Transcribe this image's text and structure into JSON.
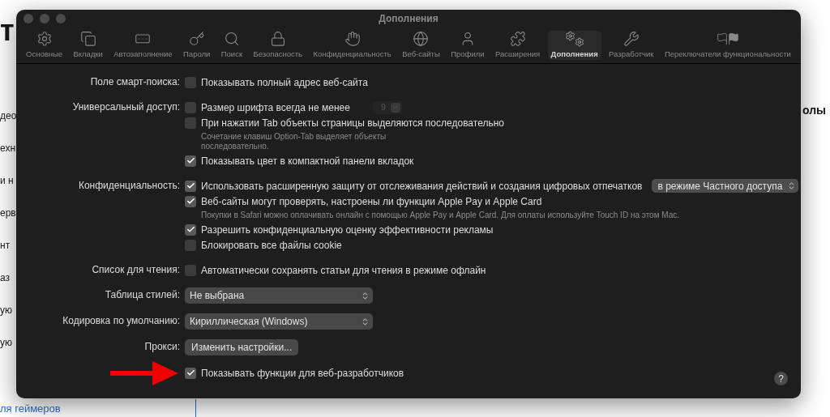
{
  "background": {
    "heading": "т",
    "fragments": [
      "део",
      "ехн",
      "и н",
      "ерв",
      "нт",
      "аз",
      "ую",
      "ую"
    ],
    "right_heading": "олы",
    "link": "ля геймеров"
  },
  "window": {
    "title": "Дополнения"
  },
  "toolbar": [
    {
      "label": "Основные",
      "selected": false
    },
    {
      "label": "Вкладки",
      "selected": false
    },
    {
      "label": "Автозаполнение",
      "selected": false
    },
    {
      "label": "Пароли",
      "selected": false
    },
    {
      "label": "Поиск",
      "selected": false
    },
    {
      "label": "Безопасность",
      "selected": false
    },
    {
      "label": "Конфиденциальность",
      "selected": false
    },
    {
      "label": "Веб-сайты",
      "selected": false
    },
    {
      "label": "Профили",
      "selected": false
    },
    {
      "label": "Расширения",
      "selected": false
    },
    {
      "label": "Дополнения",
      "selected": true
    },
    {
      "label": "Разработчик",
      "selected": false
    },
    {
      "label": "Переключатели функциональности",
      "selected": false
    }
  ],
  "sections": [
    {
      "label": "Поле смарт-поиска:",
      "items": [
        {
          "kind": "checkbox",
          "text": "Показывать полный адрес веб-сайта",
          "checked": false
        }
      ]
    },
    {
      "label": "Универсальный доступ:",
      "items": [
        {
          "kind": "checkbox",
          "text": "Размер шрифта всегда не менее",
          "checked": false,
          "stepper": {
            "value": "9",
            "disabled": true
          }
        },
        {
          "kind": "checkbox",
          "text": "При нажатии Tab объекты страницы выделяются последовательно",
          "checked": false
        },
        {
          "kind": "hint",
          "text": "Сочетание клавиш Option-Tab выделяет объекты\nпоследовательно."
        },
        {
          "kind": "checkbox",
          "text": "Показывать цвет в компактной панели вкладок",
          "checked": true
        }
      ]
    },
    {
      "label": "Конфиденциальность:",
      "items": [
        {
          "kind": "checkbox",
          "text": "Использовать расширенную защиту от отслеживания действий и создания цифровых отпечатков",
          "checked": true,
          "select": {
            "value": "в режиме Частного доступа"
          }
        },
        {
          "kind": "checkbox",
          "text": "Веб-сайты могут проверять, настроены ли функции Apple Pay и Apple Card",
          "checked": true
        },
        {
          "kind": "hint",
          "text": "Покупки в Safari можно оплачивать онлайн с помощью Apple Pay и Apple Card. Для оплаты используйте Touch ID на этом Mac."
        },
        {
          "kind": "checkbox",
          "text": "Разрешить конфиденциальную оценку эффективности рекламы",
          "checked": true
        },
        {
          "kind": "checkbox",
          "text": "Блокировать все файлы cookie",
          "checked": false
        }
      ]
    },
    {
      "label": "Список для чтения:",
      "items": [
        {
          "kind": "checkbox",
          "text": "Автоматически сохранять статьи для чтения в режиме офлайн",
          "checked": false
        }
      ]
    },
    {
      "label": "Таблица стилей:",
      "items": [
        {
          "kind": "select",
          "text": "Не выбрана"
        }
      ]
    },
    {
      "label": "Кодировка по умолчанию:",
      "items": [
        {
          "kind": "select",
          "text": "Кириллическая (Windows)"
        }
      ]
    },
    {
      "label": "Прокси:",
      "items": [
        {
          "kind": "button",
          "text": "Изменить настройки..."
        }
      ]
    },
    {
      "annotated": true,
      "items": [
        {
          "kind": "checkbox",
          "text": "Показывать функции для веб-разработчиков",
          "checked": true
        }
      ]
    }
  ],
  "help": "?"
}
